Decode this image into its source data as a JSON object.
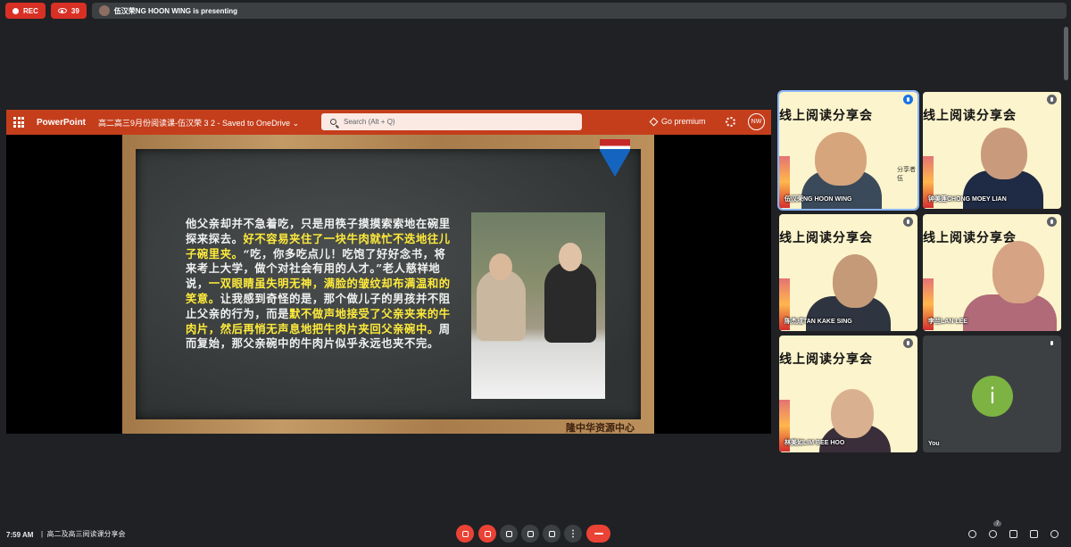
{
  "top": {
    "rec_label": "REC",
    "viewer_count": "39",
    "presenting_text": "伍汉荣NG HOON WING is presenting"
  },
  "powerpoint": {
    "brand": "PowerPoint",
    "doc_title": "高二高三9月份阅读课-伍汉荣 3 2  -  Saved to OneDrive ⌄",
    "search_placeholder": "Search (Alt + Q)",
    "premium_label": "Go premium",
    "user_initials": "NW"
  },
  "slide": {
    "text_parts": [
      {
        "t": "他父亲却并不急着吃，只是用筷子摸摸索索地在碗里探来探去。",
        "hl": false
      },
      {
        "t": "好不容易夹住了一块牛肉就忙不迭地往儿子碗里夹。",
        "hl": true
      },
      {
        "t": "“吃，你多吃点儿！吃饱了好好念书，将来考上大学，做个对社会有用的人才。”老人慈祥地说，",
        "hl": false
      },
      {
        "t": "一双眼睛虽失明无神，满脸的皱纹却布满温和的笑意。",
        "hl": true
      },
      {
        "t": "让我感到奇怪的是，那个做儿子的男孩并不阻止父亲的行为，而是",
        "hl": false
      },
      {
        "t": "默不做声地接受了父亲夹来的牛肉片，然后再悄无声息地把牛肉片夹回父亲碗中。",
        "hl": true
      },
      {
        "t": "周而复始，那父亲碗中的牛肉片似乎永远也夹不完。",
        "hl": false
      }
    ],
    "footer": "隆中华资源中心"
  },
  "tiles": [
    {
      "banner": "线上阅读分享会",
      "name": "伍汉荣NG HOON WING",
      "extra": "分享者\n伍",
      "active": true
    },
    {
      "banner": "线上阅读分享会",
      "name": "钟美莲CHONG MOEY LIAN"
    },
    {
      "banner": "线上阅读分享会",
      "name": "陈杰成TAN KAKE SING"
    },
    {
      "banner": "线上阅读分享会",
      "name": "李兰LAN LEE"
    },
    {
      "banner": "线上阅读分享会",
      "name": "林美如LIM BEE HOO"
    },
    {
      "name": "You",
      "avatar_letter": "i"
    }
  ],
  "bottom": {
    "time": "7:59 AM",
    "meeting_title": "高二及高三阅读课分享会",
    "participants_badge": "7"
  }
}
